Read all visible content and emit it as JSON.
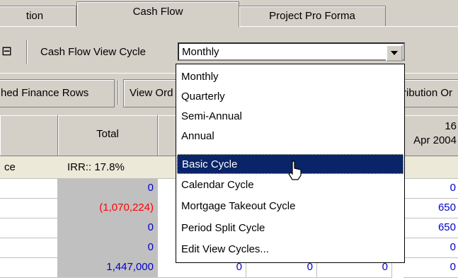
{
  "tabs": [
    {
      "label": "tion"
    },
    {
      "label": "Cash Flow"
    },
    {
      "label": "Project Pro Forma"
    }
  ],
  "toolbar": {
    "icon_glyph": "⊟",
    "view_cycle_label": "Cash Flow View Cycle",
    "view_cycle_value": "Monthly"
  },
  "row2": {
    "btn1": "hed Finance Rows",
    "btn2": "View Ord",
    "btn3": "ribution Or"
  },
  "grid": {
    "total_header": "Total",
    "col_header_num": "16",
    "col_header_date": "Apr 2004",
    "irr_left": "ce",
    "irr_text": "IRR:: 17.8%",
    "rows": [
      {
        "total": "0",
        "c2": "",
        "c3": "",
        "c4": "",
        "right": "0"
      },
      {
        "total": "(1,070,224)",
        "c2": "",
        "c3": "",
        "c4": "",
        "right": "650"
      },
      {
        "total": "0",
        "c2": "",
        "c3": "",
        "c4": "",
        "right": "650"
      },
      {
        "total": "0",
        "c2": "",
        "c3": "",
        "c4": "",
        "right": "0"
      },
      {
        "total": "1,447,000",
        "c2": "0",
        "c3": "0",
        "c4": "0",
        "right": "0"
      }
    ]
  },
  "dropdown": {
    "options": [
      "Monthly",
      "Quarterly",
      "Semi-Annual",
      "Annual",
      "Basic Cycle",
      "Calendar Cycle",
      "Mortgage Takeout Cycle",
      "Period Split Cycle",
      "Edit View Cycles..."
    ],
    "selected_index": 4
  },
  "colors": {
    "highlight": "#0a246a",
    "negative": "#ff0000",
    "positive": "#0000cc",
    "face": "#d4d0c8"
  }
}
